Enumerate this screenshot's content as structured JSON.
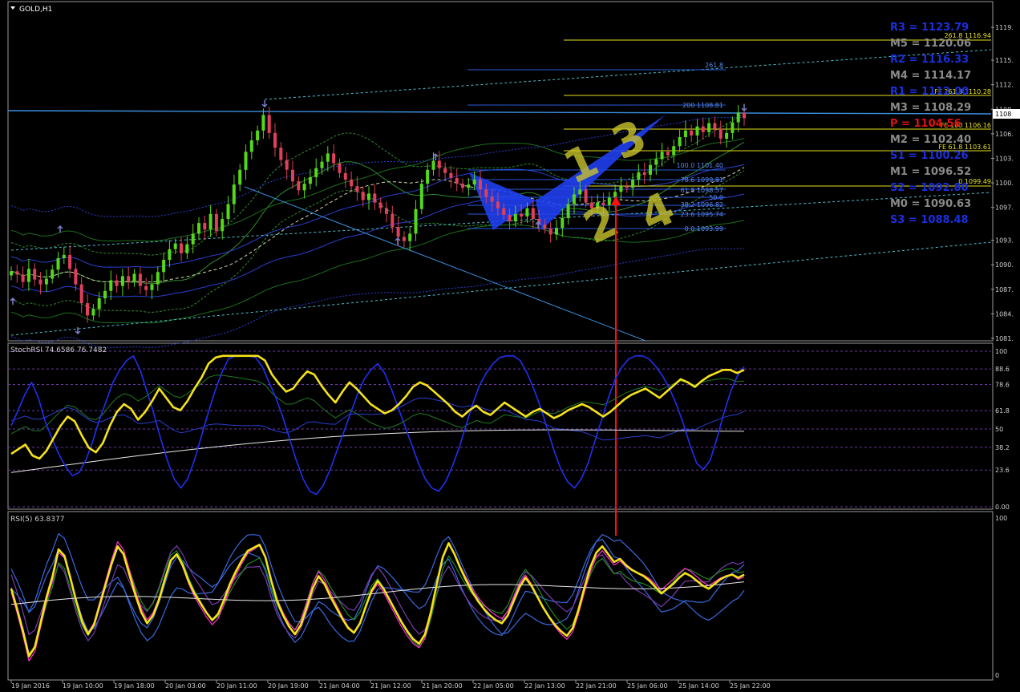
{
  "chart_data": {
    "type": "candlestick",
    "title": "GOLD,H1",
    "symbol": "GOLD",
    "timeframe": "H1",
    "price_axis": {
      "ylim": [
        1081,
        1120
      ],
      "ticks": [
        "1119.",
        "1115.",
        "1112.",
        "1109.",
        "1106.",
        "1103.",
        "1100.",
        "1097.",
        "1093.",
        "1090.",
        "1087.",
        "1084.",
        "1081."
      ],
      "current_price_tag": "1108"
    },
    "time_axis": {
      "ticks": [
        "19 Jan 2016",
        "19 Jan 10:00",
        "19 Jan 18:00",
        "20 Jan 03:00",
        "20 Jan 11:00",
        "20 Jan 19:00",
        "21 Jan 04:00",
        "21 Jan 12:00",
        "21 Jan 20:00",
        "22 Jan 05:00",
        "22 Jan 13:00",
        "22 Jan 21:00",
        "25 Jan 06:00",
        "25 Jan 14:00",
        "25 Jan 22:00"
      ]
    },
    "candles_close": [
      1089.2,
      1088.8,
      1087.9,
      1089.5,
      1088.2,
      1087.6,
      1088.3,
      1089.4,
      1090.8,
      1091.2,
      1089.5,
      1087.6,
      1085.3,
      1083.8,
      1084.6,
      1085.9,
      1086.8,
      1088.1,
      1087.4,
      1088.6,
      1087.9,
      1088.9,
      1087.4,
      1086.9,
      1087.6,
      1089.1,
      1090.6,
      1091.9,
      1092.6,
      1091.4,
      1092.5,
      1093.8,
      1095.1,
      1094.3,
      1096.2,
      1094.1,
      1095.6,
      1097.4,
      1099.8,
      1101.6,
      1103.8,
      1105.2,
      1106.4,
      1108.3,
      1106.1,
      1104.3,
      1102.8,
      1101.6,
      1100.2,
      1099.1,
      1099.9,
      1100.7,
      1101.8,
      1102.6,
      1103.6,
      1102.4,
      1101.2,
      1100.4,
      1099.6,
      1098.9,
      1097.9,
      1098.7,
      1097.6,
      1096.9,
      1096.2,
      1094.6,
      1093.4,
      1092.9,
      1093.8,
      1096.8,
      1099.9,
      1101.6,
      1102.7,
      1101.8,
      1101.2,
      1100.6,
      1099.9,
      1099.4,
      1099.8,
      1100.4,
      1099.2,
      1098.3,
      1097.7,
      1096.9,
      1096.1,
      1095.3,
      1096.2,
      1095.9,
      1096.9,
      1095.6,
      1094.9,
      1094.4,
      1093.7,
      1094.5,
      1095.7,
      1097.4,
      1098.6,
      1099.2,
      1097.6,
      1096.9,
      1097.6,
      1097.3,
      1098.2,
      1098.9,
      1099.6,
      1099.4,
      1100.4,
      1101.3,
      1101.0,
      1102.2,
      1102.9,
      1103.8,
      1103.4,
      1104.5,
      1105.6,
      1106.4,
      1105.8,
      1106.9,
      1106.2,
      1107.3,
      1106.6,
      1105.4,
      1106.1,
      1107.4,
      1108.6,
      1107.9
    ],
    "pivot_levels": [
      {
        "label": "R3 = 1123.79",
        "color": "#1a2fe0"
      },
      {
        "label": "M5 = 1120.06",
        "color": "#8a8a8a"
      },
      {
        "label": "R2 = 1116.33",
        "color": "#1a2fe0"
      },
      {
        "label": "M4 = 1114.17",
        "color": "#8a8a8a"
      },
      {
        "label": "R1 = 1112.00",
        "color": "#1a2fe0"
      },
      {
        "label": "M3 = 1108.29",
        "color": "#8a8a8a"
      },
      {
        "label": "P = 1104.56",
        "color": "#e01010"
      },
      {
        "label": "M2 = 1102.40",
        "color": "#8a8a8a"
      },
      {
        "label": "S1 = 1100.26",
        "color": "#1a2fe0"
      },
      {
        "label": "M1 = 1096.52",
        "color": "#8a8a8a"
      },
      {
        "label": "S2 = 1092.80",
        "color": "#1a2fe0"
      },
      {
        "label": "M0 = 1090.63",
        "color": "#8a8a8a"
      },
      {
        "label": "S3 = 1088.48",
        "color": "#1a2fe0"
      }
    ],
    "fib_expansion_labels": [
      "261.8 1116.94",
      "FE 161.8 1110.28",
      "FE 100 1106.16",
      "FE 61.8 1103.61",
      "0 1099.49"
    ],
    "fib_retracement_labels": [
      "261.8",
      "200 1108.81",
      "100.0 1101.40",
      "78.6 1099.81",
      "61.8 1098.57",
      "50.0",
      "38.2 1096.82",
      "23.6 1095.74",
      "0.0 1093.99"
    ],
    "wave_labels": [
      "1",
      "2",
      "3",
      "4"
    ],
    "stochrsi": {
      "label": "StochRSI 74.6586 76.7482",
      "ylim": [
        0,
        100
      ],
      "ticks": [
        "100",
        "88.6",
        "78.6",
        "61.8",
        "50",
        "38.2",
        "23.6",
        "0.00"
      ],
      "main_yellow": [
        34,
        37,
        40,
        33,
        31,
        36,
        44,
        52,
        58,
        55,
        46,
        38,
        35,
        41,
        52,
        61,
        66,
        63,
        56,
        61,
        68,
        76,
        70,
        64,
        62,
        68,
        76,
        83,
        92,
        96,
        97,
        97,
        97,
        97,
        97,
        97,
        94,
        85,
        79,
        74,
        76,
        82,
        87,
        85,
        78,
        72,
        67,
        74,
        80,
        76,
        71,
        66,
        63,
        60,
        62,
        66,
        71,
        77,
        80,
        78,
        74,
        70,
        66,
        61,
        58,
        62,
        65,
        61,
        59,
        63,
        67,
        64,
        61,
        58,
        61,
        63,
        60,
        57,
        59,
        62,
        64,
        66,
        64,
        61,
        58,
        61,
        65,
        69,
        72,
        74,
        76,
        73,
        70,
        74,
        78,
        82,
        80,
        77,
        81,
        84,
        86,
        88,
        88,
        86,
        88
      ],
      "fast_blue": [
        52,
        62,
        72,
        80,
        70,
        55,
        44,
        34,
        26,
        20,
        22,
        30,
        42,
        56,
        68,
        80,
        88,
        94,
        97,
        88,
        74,
        60,
        44,
        30,
        18,
        12,
        18,
        30,
        45,
        60,
        74,
        86,
        95,
        97,
        97,
        97,
        96,
        90,
        80,
        70,
        58,
        44,
        30,
        18,
        10,
        8,
        14,
        24,
        36,
        48,
        60,
        72,
        82,
        88,
        92,
        86,
        76,
        64,
        52,
        40,
        28,
        18,
        12,
        10,
        16,
        26,
        38,
        52,
        66,
        78,
        86,
        92,
        96,
        97,
        97,
        94,
        86,
        76,
        64,
        50,
        36,
        24,
        16,
        12,
        18,
        28,
        42,
        56,
        70,
        82,
        90,
        95,
        97,
        97,
        95,
        90,
        84,
        76,
        66,
        54,
        40,
        28,
        24,
        30,
        44,
        60,
        74,
        84,
        90
      ]
    },
    "rsi": {
      "label": "RSI(5) 63.8377",
      "ylim": [
        0,
        100
      ],
      "ticks": [
        "100",
        "0"
      ],
      "main_yellow": [
        55,
        42,
        28,
        12,
        18,
        34,
        50,
        63,
        80,
        76,
        62,
        47,
        34,
        26,
        32,
        45,
        58,
        71,
        82,
        77,
        64,
        51,
        40,
        33,
        38,
        48,
        61,
        73,
        77,
        70,
        60,
        52,
        46,
        40,
        35,
        39,
        48,
        58,
        66,
        73,
        79,
        81,
        83,
        75,
        60,
        47,
        38,
        31,
        26,
        32,
        43,
        55,
        63,
        58,
        50,
        43,
        36,
        30,
        27,
        33,
        44,
        54,
        60,
        55,
        48,
        41,
        34,
        28,
        23,
        20,
        26,
        40,
        58,
        75,
        84,
        77,
        68,
        60,
        53,
        47,
        42,
        38,
        35,
        33,
        38,
        47,
        56,
        62,
        57,
        50,
        43,
        37,
        32,
        28,
        25,
        30,
        42,
        56,
        69,
        78,
        82,
        77,
        72,
        74,
        70,
        67,
        65,
        63,
        60,
        56,
        52,
        55,
        58,
        62,
        65,
        63,
        60,
        57,
        55,
        58,
        61,
        63,
        64,
        62,
        64
      ]
    }
  }
}
